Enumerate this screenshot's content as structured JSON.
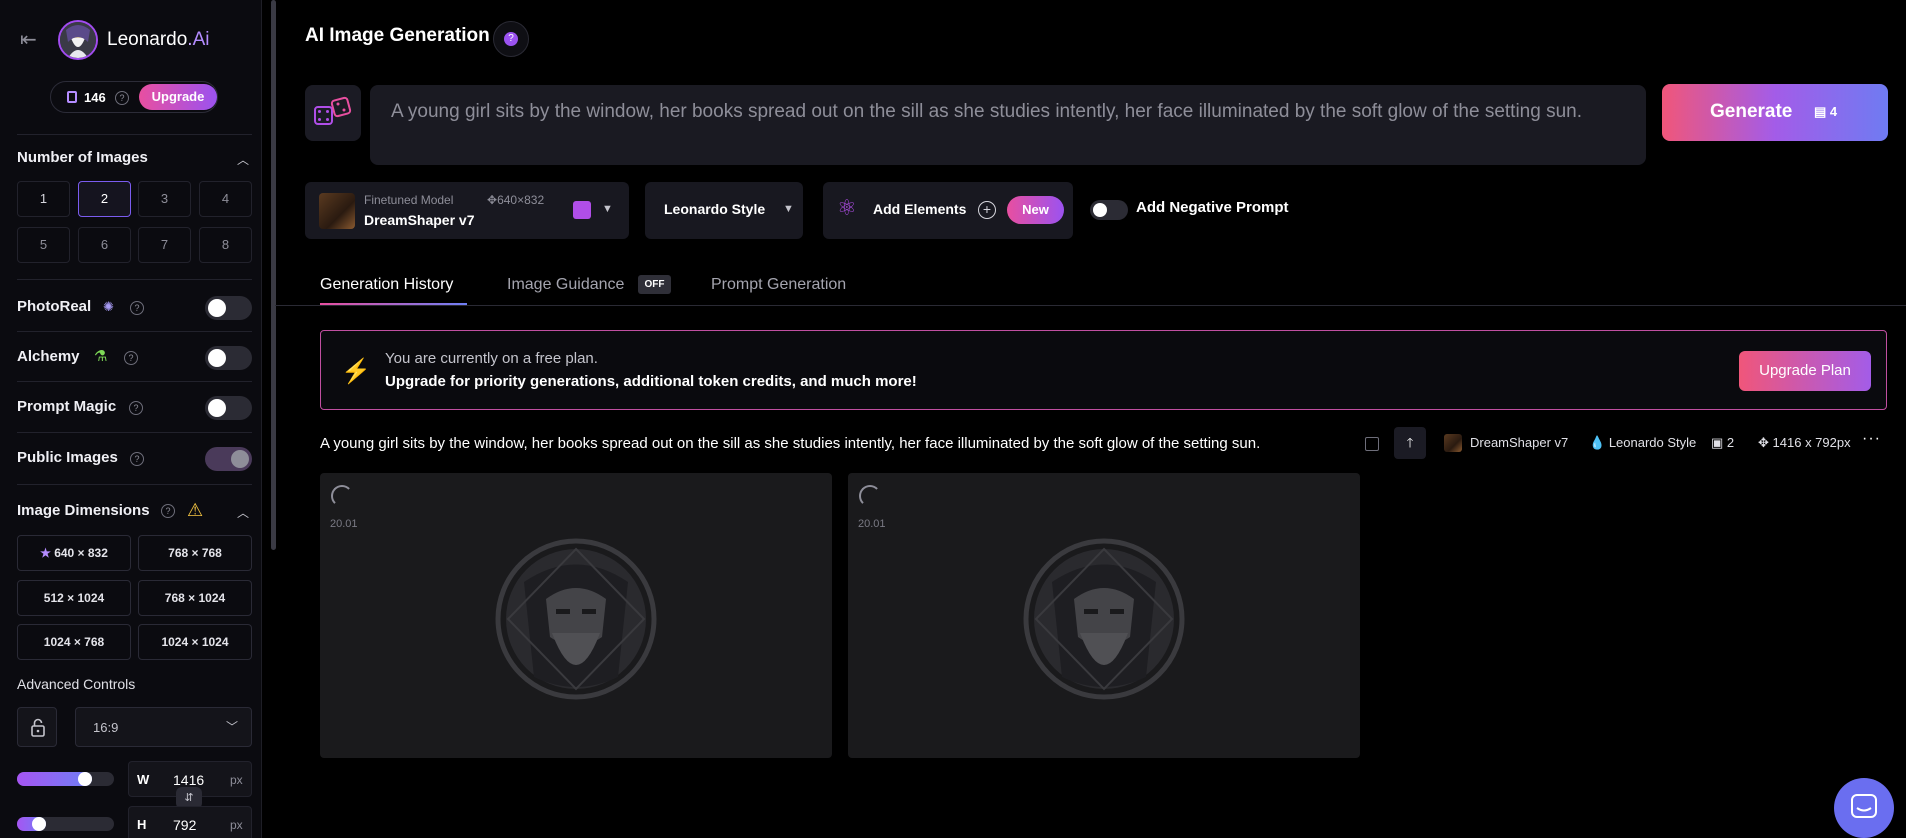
{
  "sidebar": {
    "brand": {
      "name": "Leonardo",
      "dot": ".",
      "ai": "Ai"
    },
    "tokens": {
      "count": "146",
      "help": "?",
      "upgrade_label": "Upgrade"
    },
    "number_of_images": {
      "title": "Number of Images",
      "options": [
        "1",
        "2",
        "3",
        "4",
        "5",
        "6",
        "7",
        "8"
      ],
      "selected": "2"
    },
    "toggles": {
      "photoreal": {
        "label": "PhotoReal",
        "on": false
      },
      "alchemy": {
        "label": "Alchemy",
        "on": false
      },
      "prompt_magic": {
        "label": "Prompt Magic",
        "on": false
      },
      "public_images": {
        "label": "Public Images",
        "on": true
      }
    },
    "image_dimensions": {
      "title": "Image Dimensions",
      "options": [
        "640 × 832",
        "768 × 768",
        "512 × 1024",
        "768 × 1024",
        "1024 × 768",
        "1024 × 1024"
      ]
    },
    "advanced": {
      "label": "Advanced Controls",
      "ratio": "16:9",
      "width": {
        "label": "W",
        "value": "1416",
        "unit": "px",
        "fraction": 0.74
      },
      "height": {
        "label": "H",
        "value": "792",
        "unit": "px",
        "fraction": 0.18
      }
    }
  },
  "header": {
    "title": "AI Image Generation",
    "help": "?"
  },
  "prompt": {
    "text": "A young girl sits by the window, her books spread out on the sill as she studies intently, her face illuminated by the soft glow of the setting sun."
  },
  "generate": {
    "label": "Generate",
    "cost": "4"
  },
  "model": {
    "tag": "Finetuned Model",
    "size": "640×832",
    "name": "DreamShaper v7"
  },
  "style": {
    "name": "Leonardo Style"
  },
  "elements": {
    "label": "Add Elements",
    "badge": "New"
  },
  "negative_prompt": {
    "label": "Add Negative Prompt",
    "on": false
  },
  "tabs": {
    "history": "Generation History",
    "guidance": "Image Guidance",
    "guidance_badge": "OFF",
    "prompt_gen": "Prompt Generation"
  },
  "banner": {
    "line1": "You are currently on a free plan.",
    "line2": "Upgrade for priority generations, additional token credits, and much more!",
    "button": "Upgrade Plan"
  },
  "generation": {
    "prompt": "A young girl sits by the window, her books spread out on the sill as she studies intently, her face illuminated by the soft glow of the setting sun.",
    "model": "DreamShaper v7",
    "style": "Leonardo Style",
    "count": "2",
    "dimensions": "1416 x 792px",
    "images": [
      {
        "time": "20.01"
      },
      {
        "time": "20.01"
      }
    ]
  },
  "colors": {
    "accent_pink": "#e84fa0",
    "accent_purple": "#9b52f0",
    "accent_blue": "#6e7ff5",
    "bg": "#000000",
    "sidebar_bg": "#0b0b10"
  }
}
